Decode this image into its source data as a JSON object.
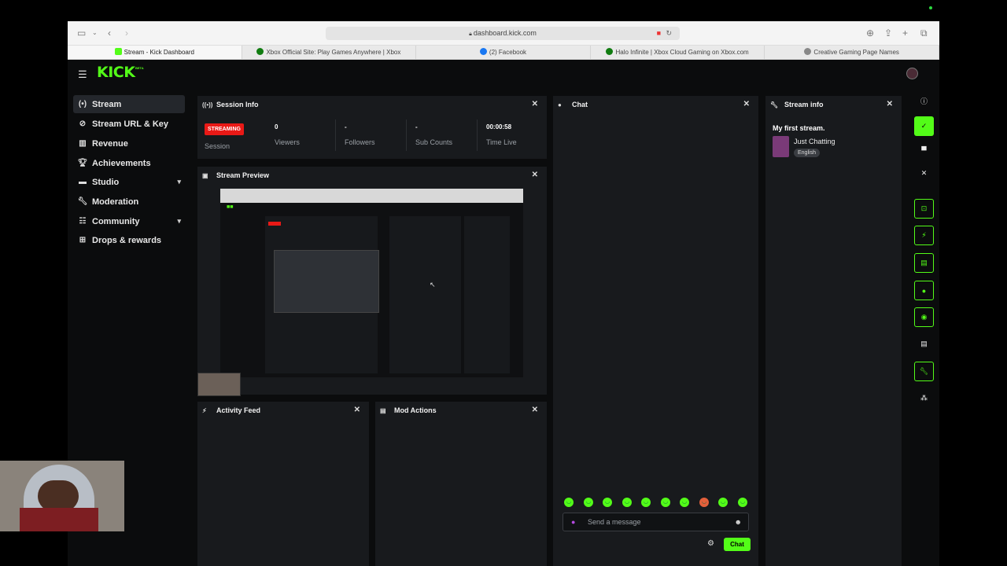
{
  "browser": {
    "url": "dashboard.kick.com",
    "tabs": [
      {
        "title": "Stream - Kick Dashboard",
        "fav": "#53fc18"
      },
      {
        "title": "Xbox Official Site: Play Games Anywhere | Xbox",
        "fav": "#107c10"
      },
      {
        "title": "(2) Facebook",
        "fav": "#1877f2"
      },
      {
        "title": "Halo Infinite | Xbox Cloud Gaming on Xbox.com",
        "fav": "#107c10"
      },
      {
        "title": "Creative Gaming Page Names",
        "fav": "#888888"
      }
    ]
  },
  "brand": {
    "logo": "KICK",
    "beta": "BETA",
    "accent": "#53fc18"
  },
  "sidebar": {
    "items": [
      {
        "label": "Stream",
        "icon": "stream-icon"
      },
      {
        "label": "Stream URL & Key",
        "icon": "link-icon"
      },
      {
        "label": "Revenue",
        "icon": "chart-icon"
      },
      {
        "label": "Achievements",
        "icon": "trophy-icon"
      },
      {
        "label": "Studio",
        "icon": "studio-icon"
      },
      {
        "label": "Moderation",
        "icon": "wrench-icon"
      },
      {
        "label": "Community",
        "icon": "community-icon"
      },
      {
        "label": "Drops & rewards",
        "icon": "drops-icon"
      }
    ]
  },
  "session": {
    "title": "Session Info",
    "badge": "STREAMING",
    "session_label": "Session",
    "stats": [
      {
        "value": "0",
        "label": "Viewers"
      },
      {
        "value": "-",
        "label": "Followers"
      },
      {
        "value": "-",
        "label": "Sub Counts"
      },
      {
        "value": "00:00:58",
        "label": "Time Live"
      }
    ]
  },
  "preview": {
    "title": "Stream Preview"
  },
  "activity": {
    "title": "Activity Feed"
  },
  "mod": {
    "title": "Mod Actions"
  },
  "chat": {
    "title": "Chat",
    "placeholder": "Send a message",
    "send_label": "Chat"
  },
  "stream_info": {
    "title": "Stream info",
    "stream_title": "My first stream.",
    "category": "Just Chatting",
    "language": "English"
  }
}
